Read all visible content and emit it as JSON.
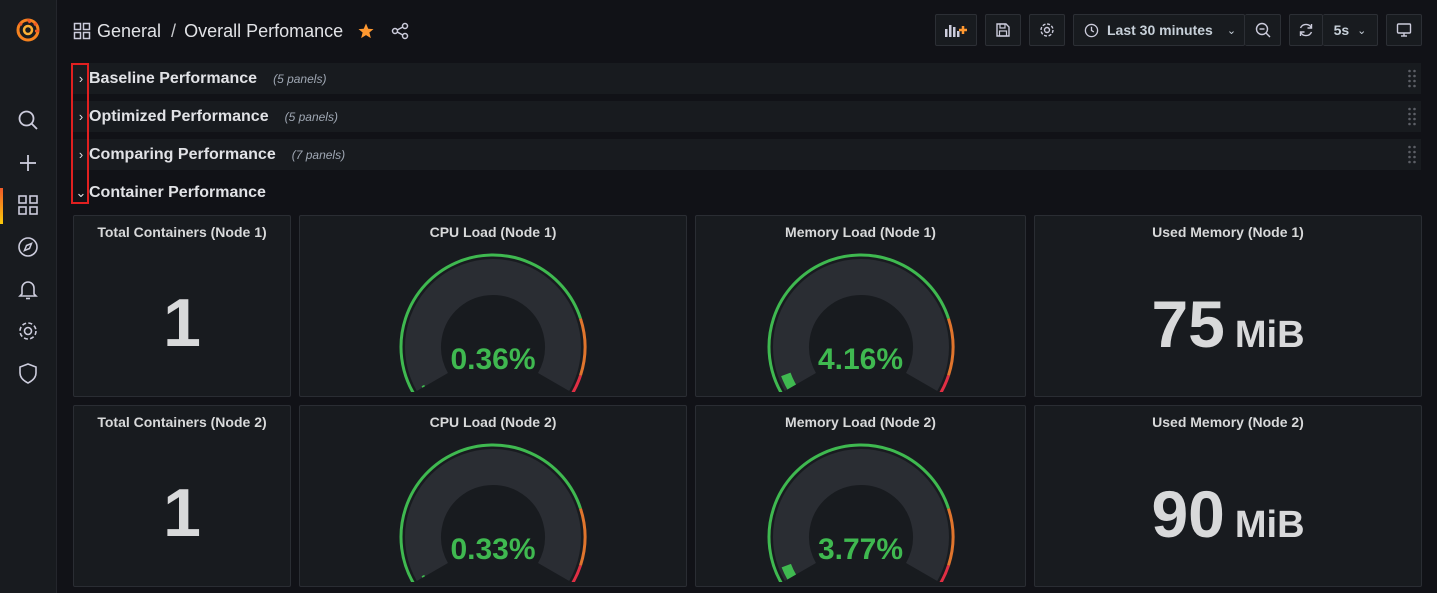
{
  "header": {
    "folder": "General",
    "separator": "/",
    "title": "Overall Perfomance"
  },
  "toolbar": {
    "time_range": "Last 30 minutes",
    "refresh_interval": "5s"
  },
  "rows": [
    {
      "title": "Baseline Performance",
      "count": "(5 panels)",
      "collapsed": true
    },
    {
      "title": "Optimized Performance",
      "count": "(5 panels)",
      "collapsed": true
    },
    {
      "title": "Comparing Performance",
      "count": "(7 panels)",
      "collapsed": true
    },
    {
      "title": "Container Performance",
      "count": "",
      "collapsed": false
    }
  ],
  "panels": {
    "node1": {
      "total_title": "Total Containers (Node 1)",
      "total_value": "1",
      "cpu_title": "CPU Load (Node 1)",
      "cpu_value": "0.36%",
      "cpu_percent": 0.36,
      "mem_title": "Memory Load (Node 1)",
      "mem_value": "4.16%",
      "mem_percent": 4.16,
      "used_title": "Used Memory (Node 1)",
      "used_value": "75",
      "used_unit": "MiB"
    },
    "node2": {
      "total_title": "Total Containers (Node 2)",
      "total_value": "1",
      "cpu_title": "CPU Load (Node 2)",
      "cpu_value": "0.33%",
      "cpu_percent": 0.33,
      "mem_title": "Memory Load (Node 2)",
      "mem_value": "3.77%",
      "mem_percent": 3.77,
      "used_title": "Used Memory (Node 2)",
      "used_value": "90",
      "used_unit": "MiB"
    }
  },
  "colors": {
    "accent": "#ff9830",
    "green": "#37872d",
    "value_green": "#3fb950",
    "orange": "#e0752d",
    "red": "#e02f44",
    "highlight": "#e02020"
  }
}
